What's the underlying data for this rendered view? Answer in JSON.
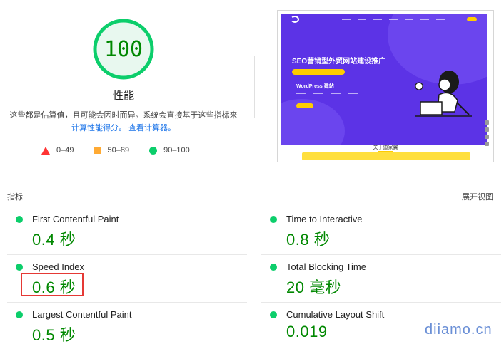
{
  "performance": {
    "score": "100",
    "score_fraction": 1.0,
    "gauge_color": "#0cce6b",
    "label": "性能",
    "description": "这些都是估算值，且可能会因时而异。系统会直接基于这些指标来",
    "link_calc": "计算性能得分。",
    "link_view": "查看计算器。"
  },
  "legend": [
    {
      "icon": "triangle-icon",
      "color": "#ff3333",
      "range": "0–49"
    },
    {
      "icon": "square-icon",
      "color": "#ffaa33",
      "range": "50–89"
    },
    {
      "icon": "circle-icon",
      "color": "#0cce6b",
      "range": "90–100"
    }
  ],
  "screenshot": {
    "hero_title": "SEO营销型外贸网站建设推广",
    "hero_sub": "WordPress 建站",
    "about_title": "关于迪家翼",
    "background": "#5c33e6",
    "accent": "#ffcc00"
  },
  "metrics_header": {
    "title": "指标",
    "toggle": "展开视图"
  },
  "metrics": [
    {
      "name": "First Contentful Paint",
      "value": "0.4 秒",
      "status": "pass"
    },
    {
      "name": "Time to Interactive",
      "value": "0.8 秒",
      "status": "pass"
    },
    {
      "name": "Speed Index",
      "value": "0.6 秒",
      "status": "pass",
      "highlighted": true
    },
    {
      "name": "Total Blocking Time",
      "value": "20 毫秒",
      "status": "pass"
    },
    {
      "name": "Largest Contentful Paint",
      "value": "0.5 秒",
      "status": "pass"
    },
    {
      "name": "Cumulative Layout Shift",
      "value": "0.019",
      "status": "pass"
    }
  ],
  "watermark": "diiamo.cn"
}
